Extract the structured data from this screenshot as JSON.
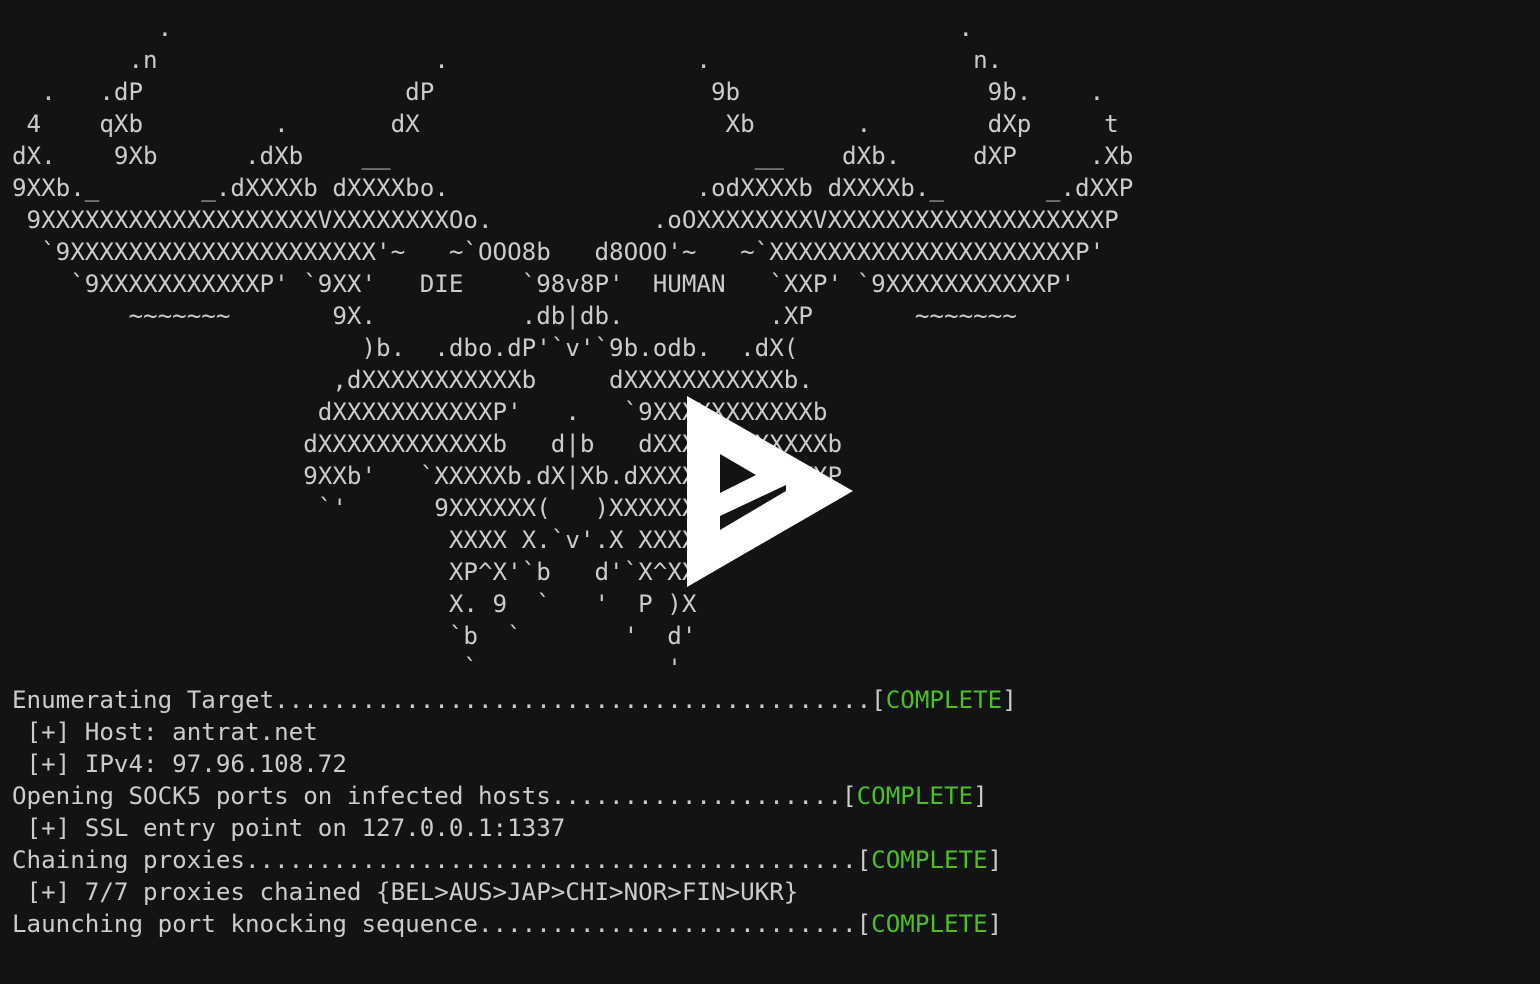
{
  "terminal": {
    "ascii_art": [
      "          .                                                      .",
      "        .n                   .                 .                  n.",
      "  .   .dP                  dP                   9b                 9b.    .",
      " 4    qXb         .       dX                     Xb       .        dXp     t",
      "dX.    9Xb      .dXb    __                         __    dXb.     dXP     .Xb",
      "9XXb._       _.dXXXXb dXXXXbo.                 .odXXXXb dXXXXb._       _.dXXP",
      " 9XXXXXXXXXXXXXXXXXXXVXXXXXXXXOo.           .oOXXXXXXXXVXXXXXXXXXXXXXXXXXXXP",
      "  `9XXXXXXXXXXXXXXXXXXXXX'~   ~`OOO8b   d8OOO'~   ~`XXXXXXXXXXXXXXXXXXXXXP'",
      "    `9XXXXXXXXXXXP' `9XX'   DIE    `98v8P'  HUMAN   `XXP' `9XXXXXXXXXXXP'",
      "        ~~~~~~~       9X.          .db|db.          .XP       ~~~~~~~",
      "                        )b.  .dbo.dP'`v'`9b.odb.  .dX(",
      "                      ,dXXXXXXXXXXXb     dXXXXXXXXXXXb.",
      "                     dXXXXXXXXXXXP'   .   `9XXXXXXXXXXXb",
      "                    dXXXXXXXXXXXXb   d|b   dXXXXXXXXXXXXb",
      "                    9XXb'   `XXXXXb.dX|Xb.dXXXXX'   `dXXP",
      "                     `'      9XXXXXX(   )XXXXXXP      `'",
      "                              XXXX X.`v'.X XXXX",
      "                              XP^X'`b   d'`X^XX",
      "                              X. 9  `   '  P )X",
      "                              `b  `       '  d'",
      "                               `             '"
    ],
    "status_lines": [
      {
        "text": "Enumerating Target.........................................[",
        "status": "COMPLETE",
        "suffix": "]"
      },
      {
        "text": " [+] Host: antrat.net"
      },
      {
        "text": " [+] IPv4: 97.96.108.72"
      },
      {
        "text": "Opening SOCK5 ports on infected hosts....................[",
        "status": "COMPLETE",
        "suffix": "]"
      },
      {
        "text": " [+] SSL entry point on 127.0.0.1:1337"
      },
      {
        "text": "Chaining proxies..........................................[",
        "status": "COMPLETE",
        "suffix": "]"
      },
      {
        "text": " [+] 7/7 proxies chained {BEL>AUS>JAP>CHI>NOR>FIN>UKR}"
      },
      {
        "text": "Launching port knocking sequence..........................[",
        "status": "COMPLETE",
        "suffix": "]"
      }
    ]
  },
  "overlay": {
    "icon": "asciinema-play-icon",
    "fill_color": "#ffffff"
  },
  "colors": {
    "background": "#121314",
    "foreground": "#cccccc",
    "status_ok": "#4ebf22"
  }
}
